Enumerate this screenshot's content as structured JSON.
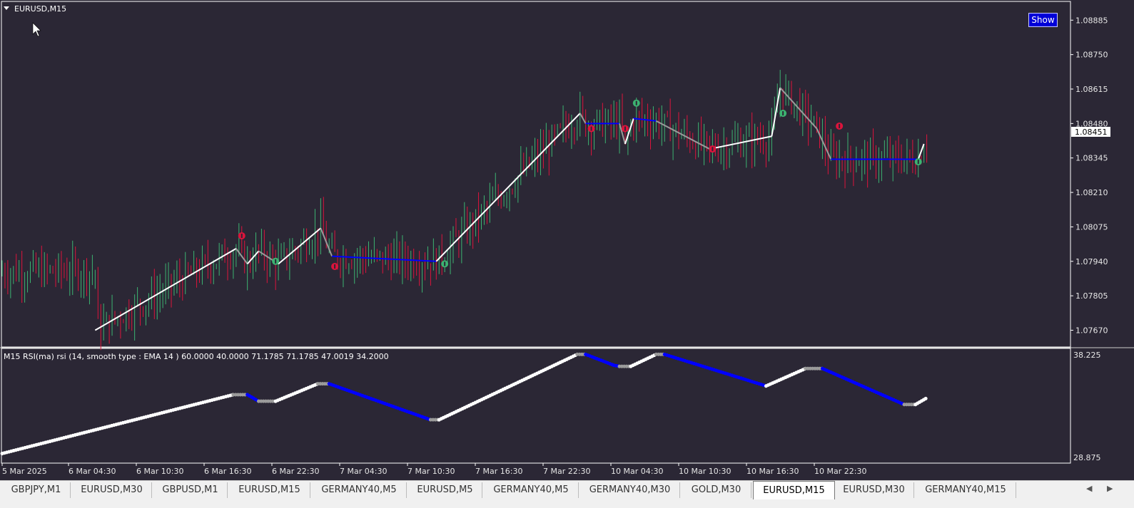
{
  "window": {
    "symbol_label": "EURUSD,M15",
    "show_button": "Show",
    "current_price": "1.08451"
  },
  "price_axis": {
    "ticks": [
      "1.08885",
      "1.08750",
      "1.08615",
      "1.08480",
      "1.08345",
      "1.08210",
      "1.08075",
      "1.07940",
      "1.07805",
      "1.07670"
    ]
  },
  "indicator": {
    "label": "M15 RSI(ma) rsi (14, smooth type : EMA  14 ) 60.0000 40.0000 71.1785 71.1785 47.0019 34.2000",
    "axis_top": "38.225",
    "axis_bottom": "28.875"
  },
  "time_axis": {
    "labels": [
      "5 Mar 2025",
      "6 Mar 04:30",
      "6 Mar 10:30",
      "6 Mar 16:30",
      "6 Mar 22:30",
      "7 Mar 04:30",
      "7 Mar 10:30",
      "7 Mar 16:30",
      "7 Mar 22:30",
      "10 Mar 04:30",
      "10 Mar 10:30",
      "10 Mar 16:30",
      "10 Mar 22:30"
    ]
  },
  "tabs": [
    "GBPJPY,M1",
    "EURUSD,M30",
    "GBPUSD,M1",
    "EURUSD,M15",
    "GERMANY40,M5",
    "EURUSD,M5",
    "GERMANY40,M5",
    "GERMANY40,M30",
    "GOLD,M30",
    "EURUSD,M15",
    "EURUSD,M30",
    "GERMANY40,M15"
  ],
  "active_tab_index": 9,
  "colors": {
    "background": "#2b2735",
    "bull_candle": "#3cb371",
    "bear_candle": "#dc143c",
    "zigzag_up": "#ffffff",
    "zigzag_down": "#0000ff",
    "zigzag_flat": "#9a9a9a"
  },
  "chart_data": {
    "type": "candlestick",
    "price_ylim": [
      1.0761,
      1.0895
    ],
    "zigzag": [
      [
        "5 Mar 22:00",
        1.0767
      ],
      [
        "6 Mar 10:30",
        1.0799
      ],
      [
        "6 Mar 11:30",
        1.0793
      ],
      [
        "6 Mar 12:30",
        1.0798
      ],
      [
        "6 Mar 14:15",
        1.0793
      ],
      [
        "6 Mar 18:00",
        1.0807
      ],
      [
        "6 Mar 19:00",
        1.0796
      ],
      [
        "7 Mar 04:15",
        1.0794
      ],
      [
        "7 Mar 17:00",
        1.0852
      ],
      [
        "7 Mar 17:30",
        1.0848
      ],
      [
        "7 Mar 20:30",
        1.0848
      ],
      [
        "7 Mar 21:00",
        1.084
      ],
      [
        "7 Mar 21:45",
        1.085
      ],
      [
        "7 Mar 23:45",
        1.0849
      ],
      [
        "10 Mar 04:30",
        1.0838
      ],
      [
        "10 Mar 10:00",
        1.0843
      ],
      [
        "10 Mar 10:45",
        1.0862
      ],
      [
        "10 Mar 14:00",
        1.0846
      ],
      [
        "10 Mar 15:15",
        1.0834
      ],
      [
        "10 Mar 23:00",
        1.0834
      ],
      [
        "10 Mar 23:30",
        1.084
      ]
    ],
    "arrows": [
      {
        "time": "6 Mar 11:00",
        "price": 1.0804,
        "dir": "down"
      },
      {
        "time": "6 Mar 14:00",
        "price": 1.0794,
        "dir": "up"
      },
      {
        "time": "6 Mar 19:15",
        "price": 1.0792,
        "dir": "down"
      },
      {
        "time": "7 Mar 05:00",
        "price": 1.0793,
        "dir": "up"
      },
      {
        "time": "7 Mar 18:00",
        "price": 1.0846,
        "dir": "down"
      },
      {
        "time": "7 Mar 21:00",
        "price": 1.0846,
        "dir": "down"
      },
      {
        "time": "7 Mar 22:00",
        "price": 1.0856,
        "dir": "up"
      },
      {
        "time": "10 Mar 04:45",
        "price": 1.0838,
        "dir": "down"
      },
      {
        "time": "10 Mar 11:00",
        "price": 1.0852,
        "dir": "up"
      },
      {
        "time": "10 Mar 16:00",
        "price": 1.0847,
        "dir": "down"
      },
      {
        "time": "10 Mar 23:00",
        "price": 1.0833,
        "dir": "up"
      }
    ],
    "rsi": {
      "ylim": [
        28.875,
        38.225
      ],
      "levels": [
        60.0,
        40.0
      ],
      "points": [
        [
          "5 Mar 13:45",
          29.1
        ],
        [
          "6 Mar 10:15",
          34.5
        ],
        [
          "6 Mar 11:30",
          34.5
        ],
        [
          "6 Mar 12:30",
          33.9
        ],
        [
          "6 Mar 14:00",
          33.9
        ],
        [
          "6 Mar 17:45",
          35.5
        ],
        [
          "6 Mar 18:45",
          35.5
        ],
        [
          "7 Mar 03:45",
          32.2
        ],
        [
          "7 Mar 04:30",
          32.2
        ],
        [
          "7 Mar 16:45",
          38.2
        ],
        [
          "7 Mar 17:30",
          38.2
        ],
        [
          "7 Mar 20:00",
          37.2
        ],
        [
          "7 Mar 20:30",
          37.1
        ],
        [
          "7 Mar 21:30",
          37.1
        ],
        [
          "7 Mar 23:45",
          38.2
        ],
        [
          "10 Mar 00:30",
          38.2
        ],
        [
          "10 Mar 09:30",
          35.3
        ],
        [
          "10 Mar 13:00",
          36.9
        ],
        [
          "10 Mar 14:30",
          36.9
        ],
        [
          "10 Mar 21:45",
          33.6
        ],
        [
          "10 Mar 22:45",
          33.6
        ],
        [
          "10 Mar 23:45",
          34.2
        ]
      ]
    }
  }
}
